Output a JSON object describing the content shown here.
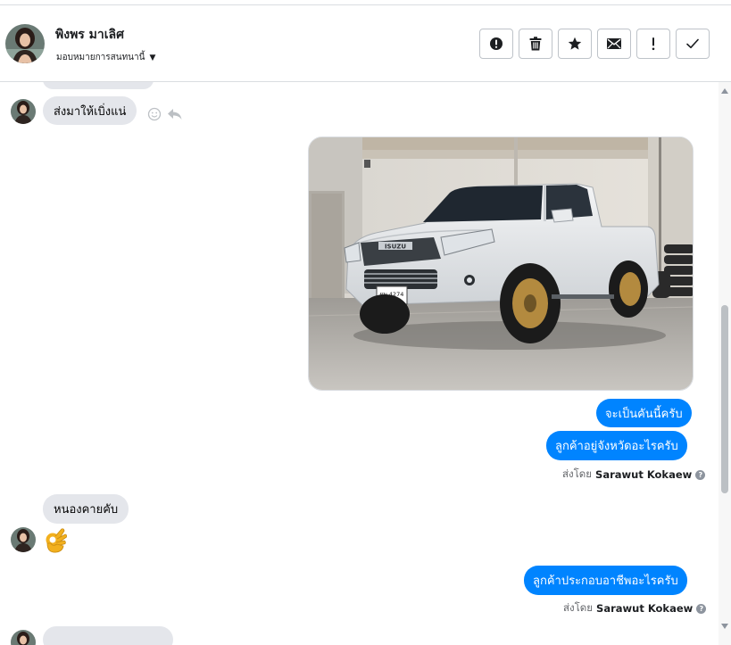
{
  "header": {
    "contact_name": "พิงพร มาเลิศ",
    "assign_label": "มอบหมายการสนทนานี้",
    "actions": [
      {
        "name": "spam-button",
        "icon": "alert-circle-icon"
      },
      {
        "name": "delete-button",
        "icon": "trash-icon"
      },
      {
        "name": "star-button",
        "icon": "star-icon"
      },
      {
        "name": "mark-unread-button",
        "icon": "envelope-icon"
      },
      {
        "name": "follow-up-button",
        "icon": "exclamation-icon"
      },
      {
        "name": "mark-done-button",
        "icon": "checkmark-icon"
      }
    ]
  },
  "messages": {
    "incoming_1": "ส่งมาให้เบิ่งแน่",
    "outgoing_1": "จะเป็นคันนี้ครับ",
    "outgoing_2": "ลูกค้าอยู่จังหวัดอะไรครับ",
    "sent_by_prefix_1": "ส่งโดย",
    "sent_by_name_1": "Sarawut Kokaew",
    "incoming_2": "หนองคายคับ",
    "outgoing_3": "ลูกค้าประกอบอาชีพอะไรครับ",
    "sent_by_prefix_2": "ส่งโดย",
    "sent_by_name_2": "Sarawut Kokaew"
  },
  "photo": {
    "plate_text": "ผพ 4274",
    "badge_text": "ISUZU"
  },
  "colors": {
    "outgoing_bubble": "#0084ff",
    "incoming_bubble": "#e4e6eb",
    "border": "#dadde1"
  }
}
